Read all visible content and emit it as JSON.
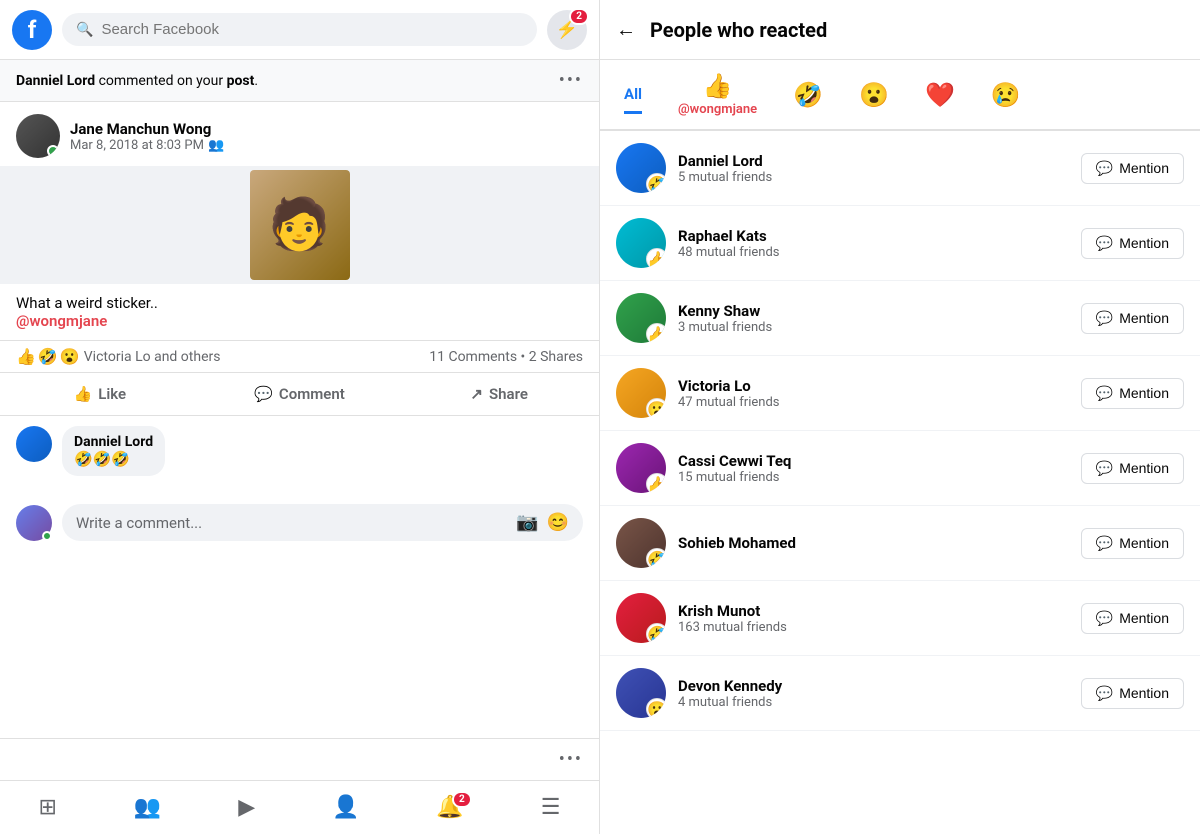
{
  "header": {
    "search_placeholder": "Search Facebook",
    "messenger_badge": "2"
  },
  "notification": {
    "text_before": "Danniel Lord",
    "text_middle": " commented on your ",
    "text_bold": "post",
    "text_after": "."
  },
  "post": {
    "author": "Jane Manchun Wong",
    "time": "Mar 8, 2018 at 8:03 PM",
    "text": "What a weird sticker..",
    "mention": "@wongmjane",
    "reactions_text": "Victoria Lo and others",
    "comments_count": "11 Comments",
    "shares_count": "2 Shares",
    "like_label": "Like",
    "comment_label": "Comment",
    "share_label": "Share"
  },
  "comment": {
    "author": "Danniel Lord",
    "text": "🤣🤣🤣"
  },
  "write_comment": {
    "placeholder": "Write a comment..."
  },
  "right_panel": {
    "title": "People who reacted",
    "tabs": [
      {
        "label": "All",
        "active": true
      },
      {
        "emoji": "👍",
        "mention": "@wongmjane"
      },
      {
        "emoji": "🤣"
      },
      {
        "emoji": "😮"
      },
      {
        "emoji": "❤️"
      },
      {
        "emoji": "😢"
      }
    ],
    "people": [
      {
        "name": "Danniel Lord",
        "mutual": "5 mutual friends",
        "reaction": "🤣",
        "avatar_color": "av-blue"
      },
      {
        "name": "Raphael Kats",
        "mutual": "48 mutual friends",
        "reaction": "👍",
        "avatar_color": "av-teal"
      },
      {
        "name": "Kenny Shaw",
        "mutual": "3 mutual friends",
        "reaction": "👍",
        "avatar_color": "av-green"
      },
      {
        "name": "Victoria Lo",
        "mutual": "47 mutual friends",
        "reaction": "😮",
        "avatar_color": "av-orange"
      },
      {
        "name": "Cassi Cewwi Teq",
        "mutual": "15 mutual friends",
        "reaction": "👍",
        "avatar_color": "av-purple"
      },
      {
        "name": "Sohieb Mohamed",
        "mutual": "",
        "reaction": "🤣",
        "avatar_color": "av-brown"
      },
      {
        "name": "Krish Munot",
        "mutual": "163 mutual friends",
        "reaction": "🤣",
        "avatar_color": "av-red"
      },
      {
        "name": "Devon Kennedy",
        "mutual": "4 mutual friends",
        "reaction": "😮",
        "avatar_color": "av-indigo"
      }
    ],
    "mention_label": "Mention"
  },
  "bottom_nav": {
    "notification_badge": "2"
  }
}
